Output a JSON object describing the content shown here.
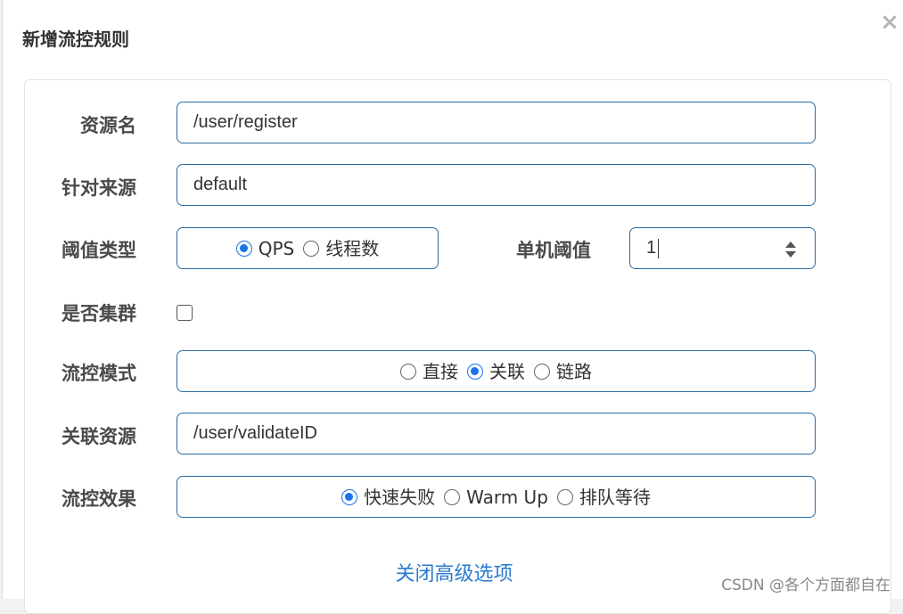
{
  "dialog": {
    "title": "新增流控规则",
    "close_glyph": "×"
  },
  "form": {
    "resource": {
      "label": "资源名",
      "value": "/user/register"
    },
    "source": {
      "label": "针对来源",
      "value": "default"
    },
    "threshold_type": {
      "label": "阈值类型",
      "options": [
        "QPS",
        "线程数"
      ],
      "selected": "QPS"
    },
    "single_threshold": {
      "label": "单机阈值",
      "value": "1"
    },
    "cluster": {
      "label": "是否集群",
      "checked": false
    },
    "flow_mode": {
      "label": "流控模式",
      "options": [
        "直接",
        "关联",
        "链路"
      ],
      "selected": "关联"
    },
    "related_resource": {
      "label": "关联资源",
      "value": "/user/validateID"
    },
    "flow_effect": {
      "label": "流控效果",
      "options": [
        "快速失败",
        "Warm Up",
        "排队等待"
      ],
      "selected": "快速失败"
    }
  },
  "advanced_link": "关闭高级选项",
  "watermark": "CSDN @各个方面都自在",
  "colors": {
    "accent": "#1a73e8",
    "border": "#2b6ca3",
    "link": "#2b7bd0"
  }
}
